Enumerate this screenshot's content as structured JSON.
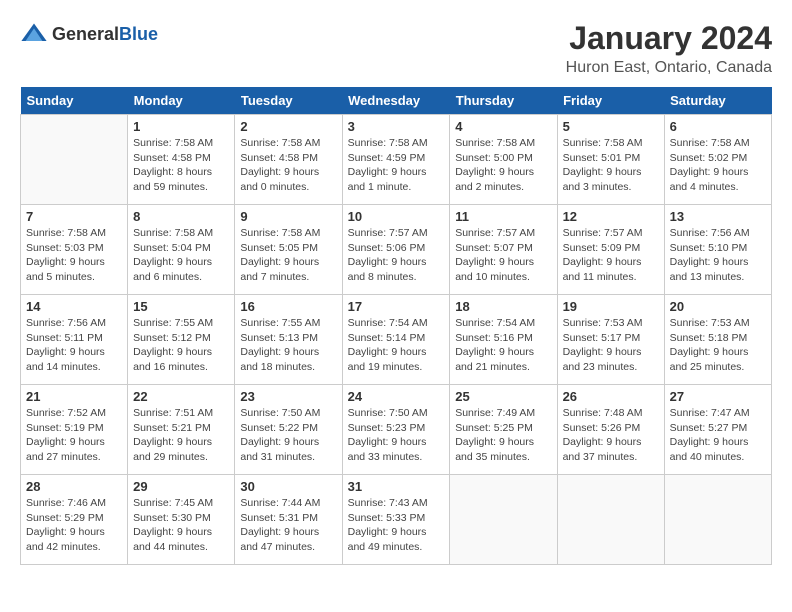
{
  "logo": {
    "general": "General",
    "blue": "Blue"
  },
  "title": "January 2024",
  "location": "Huron East, Ontario, Canada",
  "days_of_week": [
    "Sunday",
    "Monday",
    "Tuesday",
    "Wednesday",
    "Thursday",
    "Friday",
    "Saturday"
  ],
  "weeks": [
    [
      {
        "day": "",
        "info": ""
      },
      {
        "day": "1",
        "info": "Sunrise: 7:58 AM\nSunset: 4:58 PM\nDaylight: 8 hours\nand 59 minutes."
      },
      {
        "day": "2",
        "info": "Sunrise: 7:58 AM\nSunset: 4:58 PM\nDaylight: 9 hours\nand 0 minutes."
      },
      {
        "day": "3",
        "info": "Sunrise: 7:58 AM\nSunset: 4:59 PM\nDaylight: 9 hours\nand 1 minute."
      },
      {
        "day": "4",
        "info": "Sunrise: 7:58 AM\nSunset: 5:00 PM\nDaylight: 9 hours\nand 2 minutes."
      },
      {
        "day": "5",
        "info": "Sunrise: 7:58 AM\nSunset: 5:01 PM\nDaylight: 9 hours\nand 3 minutes."
      },
      {
        "day": "6",
        "info": "Sunrise: 7:58 AM\nSunset: 5:02 PM\nDaylight: 9 hours\nand 4 minutes."
      }
    ],
    [
      {
        "day": "7",
        "info": "Sunrise: 7:58 AM\nSunset: 5:03 PM\nDaylight: 9 hours\nand 5 minutes."
      },
      {
        "day": "8",
        "info": "Sunrise: 7:58 AM\nSunset: 5:04 PM\nDaylight: 9 hours\nand 6 minutes."
      },
      {
        "day": "9",
        "info": "Sunrise: 7:58 AM\nSunset: 5:05 PM\nDaylight: 9 hours\nand 7 minutes."
      },
      {
        "day": "10",
        "info": "Sunrise: 7:57 AM\nSunset: 5:06 PM\nDaylight: 9 hours\nand 8 minutes."
      },
      {
        "day": "11",
        "info": "Sunrise: 7:57 AM\nSunset: 5:07 PM\nDaylight: 9 hours\nand 10 minutes."
      },
      {
        "day": "12",
        "info": "Sunrise: 7:57 AM\nSunset: 5:09 PM\nDaylight: 9 hours\nand 11 minutes."
      },
      {
        "day": "13",
        "info": "Sunrise: 7:56 AM\nSunset: 5:10 PM\nDaylight: 9 hours\nand 13 minutes."
      }
    ],
    [
      {
        "day": "14",
        "info": "Sunrise: 7:56 AM\nSunset: 5:11 PM\nDaylight: 9 hours\nand 14 minutes."
      },
      {
        "day": "15",
        "info": "Sunrise: 7:55 AM\nSunset: 5:12 PM\nDaylight: 9 hours\nand 16 minutes."
      },
      {
        "day": "16",
        "info": "Sunrise: 7:55 AM\nSunset: 5:13 PM\nDaylight: 9 hours\nand 18 minutes."
      },
      {
        "day": "17",
        "info": "Sunrise: 7:54 AM\nSunset: 5:14 PM\nDaylight: 9 hours\nand 19 minutes."
      },
      {
        "day": "18",
        "info": "Sunrise: 7:54 AM\nSunset: 5:16 PM\nDaylight: 9 hours\nand 21 minutes."
      },
      {
        "day": "19",
        "info": "Sunrise: 7:53 AM\nSunset: 5:17 PM\nDaylight: 9 hours\nand 23 minutes."
      },
      {
        "day": "20",
        "info": "Sunrise: 7:53 AM\nSunset: 5:18 PM\nDaylight: 9 hours\nand 25 minutes."
      }
    ],
    [
      {
        "day": "21",
        "info": "Sunrise: 7:52 AM\nSunset: 5:19 PM\nDaylight: 9 hours\nand 27 minutes."
      },
      {
        "day": "22",
        "info": "Sunrise: 7:51 AM\nSunset: 5:21 PM\nDaylight: 9 hours\nand 29 minutes."
      },
      {
        "day": "23",
        "info": "Sunrise: 7:50 AM\nSunset: 5:22 PM\nDaylight: 9 hours\nand 31 minutes."
      },
      {
        "day": "24",
        "info": "Sunrise: 7:50 AM\nSunset: 5:23 PM\nDaylight: 9 hours\nand 33 minutes."
      },
      {
        "day": "25",
        "info": "Sunrise: 7:49 AM\nSunset: 5:25 PM\nDaylight: 9 hours\nand 35 minutes."
      },
      {
        "day": "26",
        "info": "Sunrise: 7:48 AM\nSunset: 5:26 PM\nDaylight: 9 hours\nand 37 minutes."
      },
      {
        "day": "27",
        "info": "Sunrise: 7:47 AM\nSunset: 5:27 PM\nDaylight: 9 hours\nand 40 minutes."
      }
    ],
    [
      {
        "day": "28",
        "info": "Sunrise: 7:46 AM\nSunset: 5:29 PM\nDaylight: 9 hours\nand 42 minutes."
      },
      {
        "day": "29",
        "info": "Sunrise: 7:45 AM\nSunset: 5:30 PM\nDaylight: 9 hours\nand 44 minutes."
      },
      {
        "day": "30",
        "info": "Sunrise: 7:44 AM\nSunset: 5:31 PM\nDaylight: 9 hours\nand 47 minutes."
      },
      {
        "day": "31",
        "info": "Sunrise: 7:43 AM\nSunset: 5:33 PM\nDaylight: 9 hours\nand 49 minutes."
      },
      {
        "day": "",
        "info": ""
      },
      {
        "day": "",
        "info": ""
      },
      {
        "day": "",
        "info": ""
      }
    ]
  ]
}
